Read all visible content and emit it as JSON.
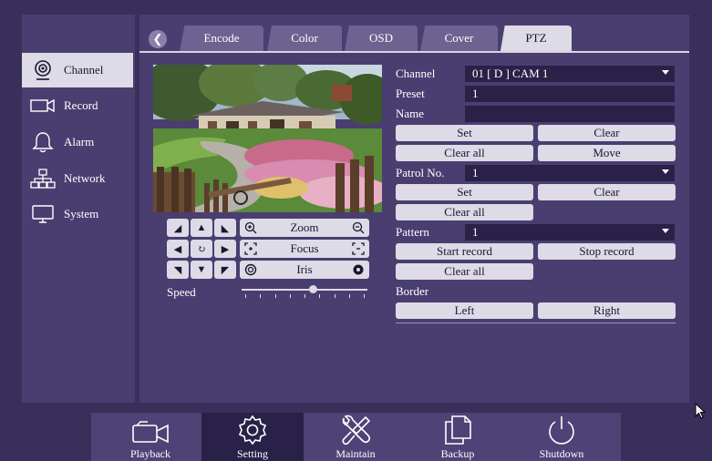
{
  "sidebar": {
    "items": [
      {
        "label": "Channel",
        "icon": "webcam-icon",
        "active": true
      },
      {
        "label": "Record",
        "icon": "video-camera-icon",
        "active": false
      },
      {
        "label": "Alarm",
        "icon": "bell-icon",
        "active": false
      },
      {
        "label": "Network",
        "icon": "network-icon",
        "active": false
      },
      {
        "label": "System",
        "icon": "monitor-icon",
        "active": false
      }
    ]
  },
  "tabs": [
    "Encode",
    "Color",
    "OSD",
    "Cover",
    "PTZ"
  ],
  "active_tab": "PTZ",
  "ptz": {
    "zoom_label": "Zoom",
    "focus_label": "Focus",
    "iris_label": "Iris",
    "speed_label": "Speed",
    "speed_value": 0.57
  },
  "form": {
    "channel_label": "Channel",
    "channel_value": "01 [ D ] CAM 1",
    "preset_label": "Preset",
    "preset_value": "1",
    "name_label": "Name",
    "name_value": "",
    "set_label": "Set",
    "clear_label": "Clear",
    "clear_all_label": "Clear all",
    "move_label": "Move",
    "patrol_label": "Patrol No.",
    "patrol_value": "1",
    "patrol_set_label": "Set",
    "patrol_clear_label": "Clear",
    "patrol_clear_all_label": "Clear all",
    "pattern_label": "Pattern",
    "pattern_value": "1",
    "start_record_label": "Start record",
    "stop_record_label": "Stop record",
    "pattern_clear_all_label": "Clear all",
    "border_label": "Border",
    "left_label": "Left",
    "right_label": "Right"
  },
  "bottom": {
    "items": [
      {
        "label": "Playback",
        "icon": "camcorder-icon"
      },
      {
        "label": "Setting",
        "icon": "gear-icon"
      },
      {
        "label": "Maintain",
        "icon": "tools-icon"
      },
      {
        "label": "Backup",
        "icon": "copy-icon"
      },
      {
        "label": "Shutdown",
        "icon": "power-icon"
      }
    ],
    "active": "Setting"
  },
  "colors": {
    "background": "#3a2f5a",
    "panel": "#4a3e70",
    "button": "#dcdbe6",
    "field": "#2a2148",
    "tab": "#6d6391"
  }
}
